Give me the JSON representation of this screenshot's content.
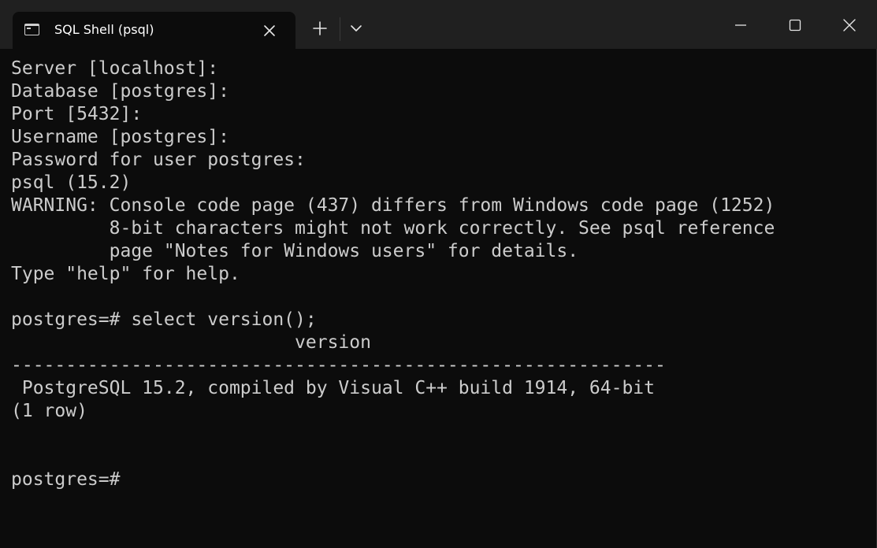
{
  "window": {
    "tab_title": "SQL Shell (psql)",
    "icons": {
      "tab": "terminal-icon",
      "tab_close": "close-icon",
      "new_tab": "plus-icon",
      "dropdown": "chevron-down-icon",
      "minimize": "minimize-icon",
      "maximize": "maximize-icon",
      "close": "close-icon"
    },
    "colors": {
      "titlebar": "#202020",
      "background": "#0c0c0c",
      "text": "#cccccc"
    }
  },
  "terminal": {
    "lines": [
      "Server [localhost]:",
      "Database [postgres]:",
      "Port [5432]:",
      "Username [postgres]:",
      "Password for user postgres:",
      "psql (15.2)",
      "WARNING: Console code page (437) differs from Windows code page (1252)",
      "         8-bit characters might not work correctly. See psql reference",
      "         page \"Notes for Windows users\" for details.",
      "Type \"help\" for help.",
      "",
      "postgres=# select version();",
      "                          version",
      "------------------------------------------------------------",
      " PostgreSQL 15.2, compiled by Visual C++ build 1914, 64-bit",
      "(1 row)",
      "",
      "",
      "postgres=#"
    ]
  }
}
